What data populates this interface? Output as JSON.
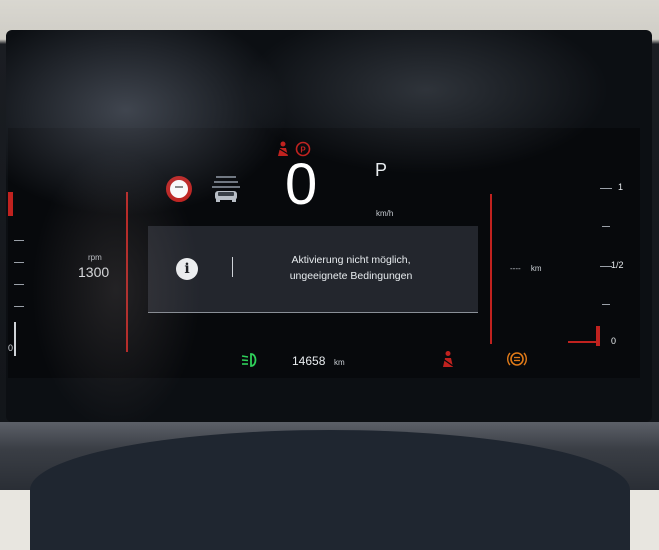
{
  "cluster": {
    "tachometer": {
      "unit_label": "rpm",
      "value": "1300",
      "scale_zero": "0"
    },
    "speed": {
      "value": "0",
      "unit": "km/h"
    },
    "gear": "P",
    "message": {
      "line1": "Aktivierung nicht möglich,",
      "line2": "ungeeignete Bedingungen"
    },
    "fuel": {
      "range_value": "----",
      "range_unit": "km",
      "scale": {
        "full": "1",
        "half": "1/2",
        "empty": "0"
      }
    },
    "odometer": {
      "value": "14658",
      "unit": "km"
    }
  },
  "icons": {
    "seatbelt_parking_warning": "seatbelt-warning-icon",
    "speed_limit_sign": "speed-limit-sign-icon",
    "lane_assist": "lane-assist-car-icon",
    "info": "info-icon",
    "low_beam": "low-beam-icon",
    "seatbelt_bottom": "seatbelt-warning-icon",
    "brake": "brake-warning-icon"
  },
  "colors": {
    "warning_red": "#c0221f",
    "indicator_green": "#2fd05a",
    "indicator_orange": "#e07a18",
    "text_white": "#e8ecef"
  }
}
